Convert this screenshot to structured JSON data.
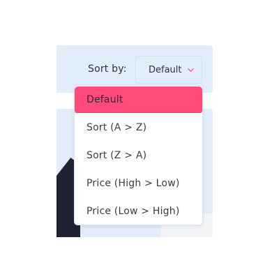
{
  "sort": {
    "label": "Sort by:",
    "selected": "Default",
    "accent_color": "#ff4a7a",
    "options": [
      "Default",
      "Sort (A > Z)",
      "Sort (Z > A)",
      "Price (High > Low)",
      "Price (Low > High)"
    ]
  }
}
